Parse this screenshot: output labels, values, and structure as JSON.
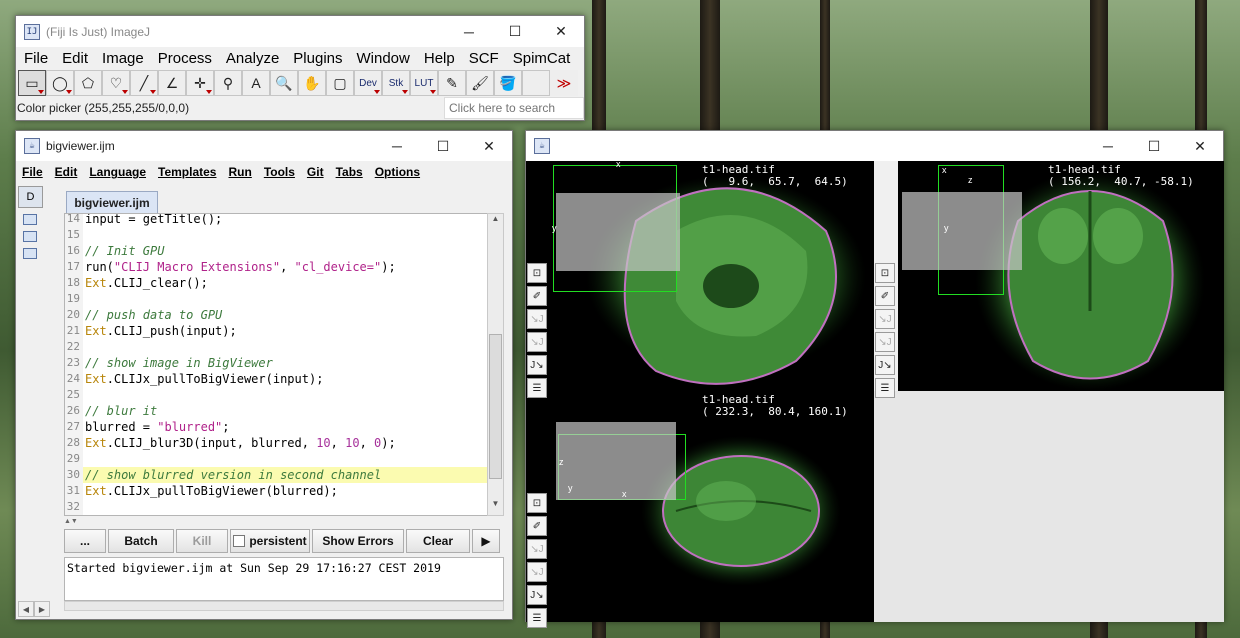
{
  "imagej": {
    "title": "(Fiji Is Just) ImageJ",
    "menus": [
      "File",
      "Edit",
      "Image",
      "Process",
      "Analyze",
      "Plugins",
      "Window",
      "Help",
      "SCF",
      "SpimCat"
    ],
    "tools": [
      {
        "icon": "rectangle-tool-icon",
        "glyph": "▭"
      },
      {
        "icon": "oval-tool-icon",
        "glyph": "◯"
      },
      {
        "icon": "polygon-tool-icon",
        "glyph": "⬠"
      },
      {
        "icon": "freehand-tool-icon",
        "glyph": "♡"
      },
      {
        "icon": "line-tool-icon",
        "glyph": "╱"
      },
      {
        "icon": "angle-tool-icon",
        "glyph": "∠"
      },
      {
        "icon": "point-tool-icon",
        "glyph": "✛"
      },
      {
        "icon": "wand-tool-icon",
        "glyph": "⚲"
      },
      {
        "icon": "text-tool-icon",
        "glyph": "A"
      },
      {
        "icon": "magnifier-tool-icon",
        "glyph": "🔍"
      },
      {
        "icon": "hand-tool-icon",
        "glyph": "✋"
      },
      {
        "icon": "color-picker-tool-icon",
        "glyph": "▢"
      },
      {
        "icon": "dev-tool-icon",
        "glyph": "Dev"
      },
      {
        "icon": "stk-tool-icon",
        "glyph": "Stk"
      },
      {
        "icon": "lut-tool-icon",
        "glyph": "LUT"
      },
      {
        "icon": "pencil-tool-icon",
        "glyph": "✎"
      },
      {
        "icon": "brush-tool-icon",
        "glyph": "🖌"
      },
      {
        "icon": "flood-fill-tool-icon",
        "glyph": "🪣"
      },
      {
        "icon": "empty-tool-icon",
        "glyph": ""
      },
      {
        "icon": "more-tools-icon",
        "glyph": "≫"
      }
    ],
    "status": "Color picker (255,255,255/0,0,0)",
    "search_placeholder": "Click here to search"
  },
  "editor": {
    "title": "bigviewer.ijm",
    "menus": [
      "File",
      "Edit",
      "Language",
      "Templates",
      "Run",
      "Tools",
      "Git",
      "Tabs",
      "Options"
    ],
    "tab": "bigviewer.ijm",
    "lines": [
      {
        "n": "14",
        "parts": [
          {
            "t": "input = getTitle();",
            "c": ""
          }
        ]
      },
      {
        "n": "15",
        "parts": []
      },
      {
        "n": "16",
        "parts": [
          {
            "t": "// Init GPU",
            "c": "c-com"
          }
        ]
      },
      {
        "n": "17",
        "parts": [
          {
            "t": "run(",
            "c": ""
          },
          {
            "t": "\"CLIJ Macro Extensions\"",
            "c": "c-str"
          },
          {
            "t": ", ",
            "c": ""
          },
          {
            "t": "\"cl_device=\"",
            "c": "c-str"
          },
          {
            "t": ");",
            "c": ""
          }
        ]
      },
      {
        "n": "18",
        "parts": [
          {
            "t": "Ext",
            "c": "c-obj"
          },
          {
            "t": ".CLIJ_clear();",
            "c": ""
          }
        ]
      },
      {
        "n": "19",
        "parts": []
      },
      {
        "n": "20",
        "parts": [
          {
            "t": "// push data to GPU",
            "c": "c-com"
          }
        ]
      },
      {
        "n": "21",
        "parts": [
          {
            "t": "Ext",
            "c": "c-obj"
          },
          {
            "t": ".CLIJ_push(input);",
            "c": ""
          }
        ]
      },
      {
        "n": "22",
        "parts": []
      },
      {
        "n": "23",
        "parts": [
          {
            "t": "// show image in BigViewer",
            "c": "c-com"
          }
        ]
      },
      {
        "n": "24",
        "parts": [
          {
            "t": "Ext",
            "c": "c-obj"
          },
          {
            "t": ".CLIJx_pullToBigViewer(input);",
            "c": ""
          }
        ]
      },
      {
        "n": "25",
        "parts": []
      },
      {
        "n": "26",
        "parts": [
          {
            "t": "// blur it",
            "c": "c-com"
          }
        ]
      },
      {
        "n": "27",
        "parts": [
          {
            "t": "blurred = ",
            "c": ""
          },
          {
            "t": "\"blurred\"",
            "c": "c-str"
          },
          {
            "t": ";",
            "c": ""
          }
        ]
      },
      {
        "n": "28",
        "parts": [
          {
            "t": "Ext",
            "c": "c-obj"
          },
          {
            "t": ".CLIJ_blur3D(input, blurred, ",
            "c": ""
          },
          {
            "t": "10",
            "c": "c-num"
          },
          {
            "t": ", ",
            "c": ""
          },
          {
            "t": "10",
            "c": "c-num"
          },
          {
            "t": ", ",
            "c": ""
          },
          {
            "t": "0",
            "c": "c-num"
          },
          {
            "t": ");",
            "c": ""
          }
        ]
      },
      {
        "n": "29",
        "parts": []
      },
      {
        "n": "30",
        "parts": [
          {
            "t": "// show blurred version in second channel",
            "c": "c-com"
          }
        ],
        "highlight": true
      },
      {
        "n": "31",
        "parts": [
          {
            "t": "Ext",
            "c": "c-obj"
          },
          {
            "t": ".CLIJx_pullToBigViewer(blurred);",
            "c": ""
          }
        ]
      },
      {
        "n": "32",
        "parts": []
      }
    ],
    "buttons": {
      "more": "...",
      "batch": "Batch",
      "kill": "Kill",
      "persistent": "persistent",
      "show_errors": "Show Errors",
      "clear": "Clear",
      "arrow": "▶"
    },
    "console": "Started bigviewer.ijm at Sun Sep 29 17:16:27 CEST 2019"
  },
  "bigviewer": {
    "panels": [
      {
        "name": "t1-head.tif",
        "coords": "(   9.6,  65.7,  64.5)"
      },
      {
        "name": "t1-head.tif",
        "coords": "( 156.2,  40.7, -58.1)"
      },
      {
        "name": "t1-head.tif",
        "coords": "( 232.3,  80.4, 160.1)"
      }
    ],
    "box_labels": {
      "x": "x",
      "y": "y",
      "z": "z"
    },
    "side_tools": [
      {
        "icon": "magnify-tool-icon",
        "glyph": "⊡"
      },
      {
        "icon": "eyedropper-tool-icon",
        "glyph": "✐"
      },
      {
        "icon": "rotate-x-icon",
        "glyph": "↘J"
      },
      {
        "icon": "rotate-y-icon",
        "glyph": "↘J"
      },
      {
        "icon": "rotate-z-icon",
        "glyph": "J↘"
      },
      {
        "icon": "settings-list-icon",
        "glyph": "☰"
      }
    ]
  }
}
